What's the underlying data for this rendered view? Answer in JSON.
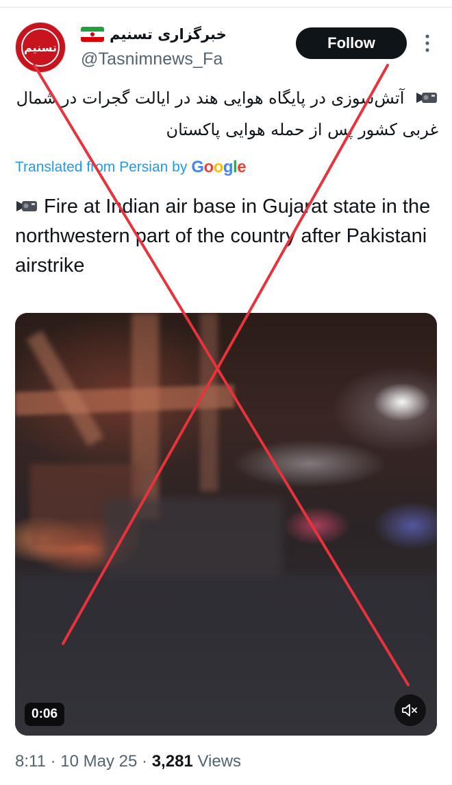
{
  "account": {
    "display_name": "خبرگزاری تسنیم",
    "handle": "@Tasnimnews_Fa",
    "avatar_text": "تسنیم",
    "follow_label": "Follow"
  },
  "tweet": {
    "persian_text": "آتش‌سوزی در پایگاه هوایی هند در ایالت گجرات در شمال غربی کشور پس از حمله هوایی پاکستان",
    "translated_label": "Translated from Persian by",
    "google_label": "Google",
    "english_text": "Fire at Indian air base in Gujarat state in the northwestern part of the country after Pakistani airstrike"
  },
  "video": {
    "duration": "0:06"
  },
  "meta": {
    "time": "8:11",
    "date": "10 May 25",
    "views_count": "3,281",
    "views_label": "Views"
  },
  "colors": {
    "follow_bg": "#0f1419",
    "link_blue": "#1d9bf0",
    "secondary_text": "#536471",
    "cross_red": "#e8323c",
    "avatar_red": "#c8141e"
  },
  "icons": {
    "more": "more-vertical-icon",
    "mute": "speaker-muted-icon",
    "emoji": "video-camera-icon",
    "flag": "iran-flag-icon"
  }
}
